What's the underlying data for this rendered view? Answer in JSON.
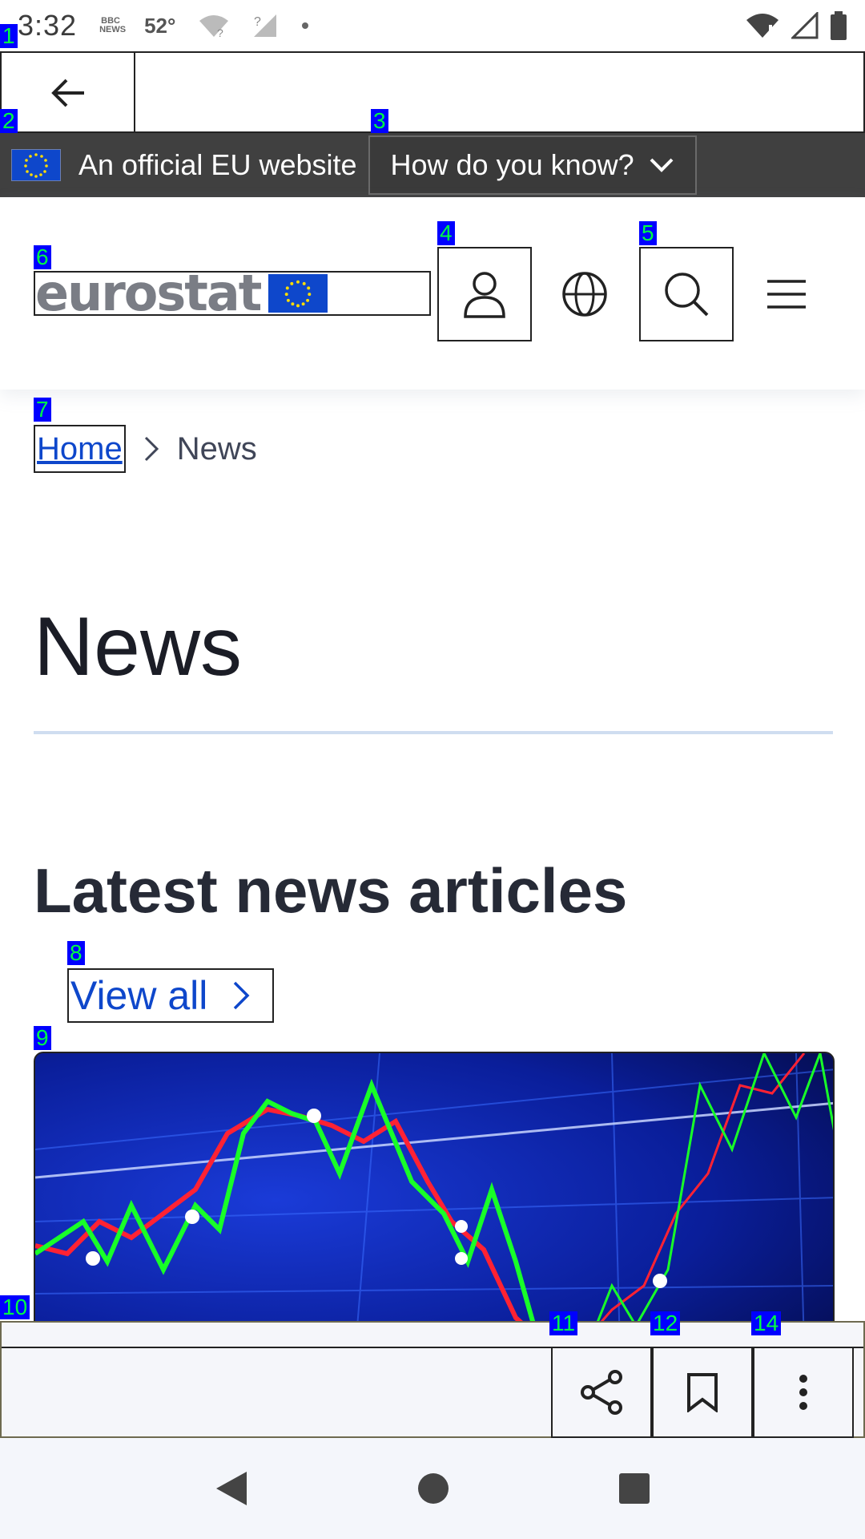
{
  "status_bar": {
    "time": "3:32",
    "news_badge": "BBC NEWS",
    "temperature": "52°"
  },
  "browser": {
    "back_label": "Back"
  },
  "eu_banner": {
    "text": "An official EU website",
    "how_button": "How do you know?"
  },
  "header": {
    "logo_text": "eurostat"
  },
  "breadcrumb": {
    "home": "Home",
    "current": "News"
  },
  "page": {
    "title": "News",
    "section_title": "Latest news articles",
    "view_all": "View all"
  },
  "markers": [
    "1",
    "2",
    "3",
    "4",
    "5",
    "6",
    "7",
    "8",
    "9",
    "10",
    "11",
    "12",
    "14"
  ],
  "colors": {
    "eu_blue": "#0e47cb",
    "banner_bg": "#404040",
    "chart_bg": "#0a1a7a"
  }
}
